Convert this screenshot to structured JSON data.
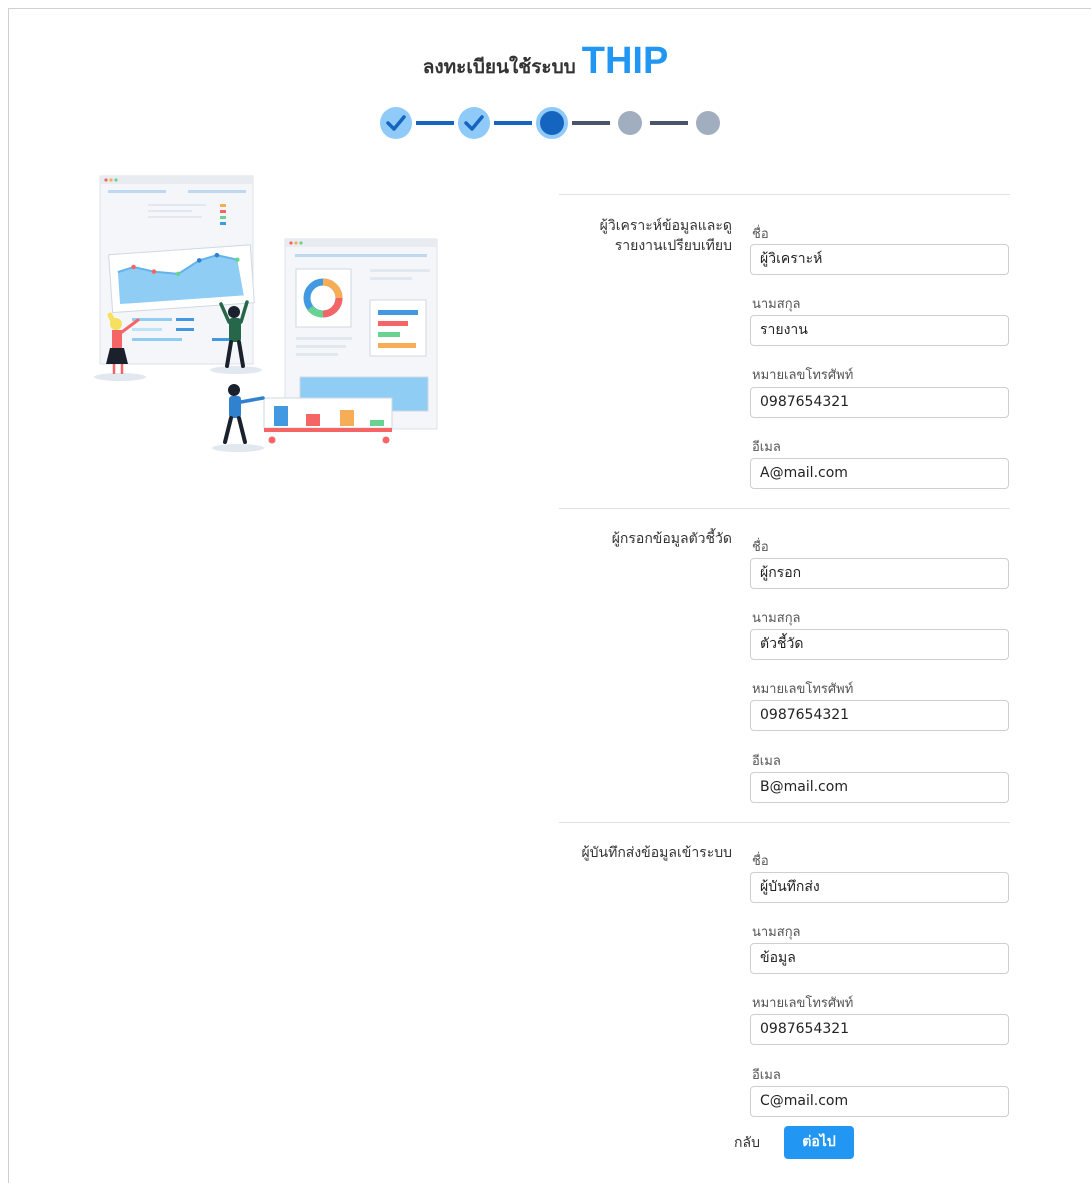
{
  "header": {
    "title_prefix": "ลงทะเบียนใช้ระบบ",
    "title_brand": "THIP",
    "brand_color": "#2196f3"
  },
  "stepper": {
    "total_steps": 5,
    "current_step": 3,
    "completed_steps": 2
  },
  "sections": [
    {
      "label": "ผู้วิเคราะห์ข้อมูลและดูรายงานเปรียบเทียบ",
      "label_lines": [
        "ผู้วิเคราะห์ข้อมูลและดู",
        "รายงานเปรียบเทียบ"
      ],
      "fields": {
        "first_name_label": "ชื่อ",
        "first_name": "ผู้วิเคราะห์",
        "last_name_label": "นามสกุล",
        "last_name": "รายงาน",
        "phone_label": "หมายเลขโทรศัพท์",
        "phone": "0987654321",
        "email_label": "อีเมล",
        "email": "A@mail.com"
      }
    },
    {
      "label": "ผู้กรอกข้อมูลตัวชี้วัด",
      "label_lines": [
        "ผู้กรอกข้อมูลตัวชี้วัด"
      ],
      "fields": {
        "first_name_label": "ชื่อ",
        "first_name": "ผู้กรอก",
        "last_name_label": "นามสกุล",
        "last_name": "ตัวชี้วัด",
        "phone_label": "หมายเลขโทรศัพท์",
        "phone": "0987654321",
        "email_label": "อีเมล",
        "email": "B@mail.com"
      }
    },
    {
      "label": "ผู้บันทึกส่งข้อมูลเข้าระบบ",
      "label_lines": [
        "ผู้บันทึกส่งข้อมูลเข้าระบบ"
      ],
      "fields": {
        "first_name_label": "ชื่อ",
        "first_name": "ผู้บันทึกส่ง",
        "last_name_label": "นามสกุล",
        "last_name": "ข้อมูล",
        "phone_label": "หมายเลขโทรศัพท์",
        "phone": "0987654321",
        "email_label": "อีเมล",
        "email": "C@mail.com"
      }
    }
  ],
  "actions": {
    "back_label": "กลับ",
    "next_label": "ต่อไป"
  }
}
